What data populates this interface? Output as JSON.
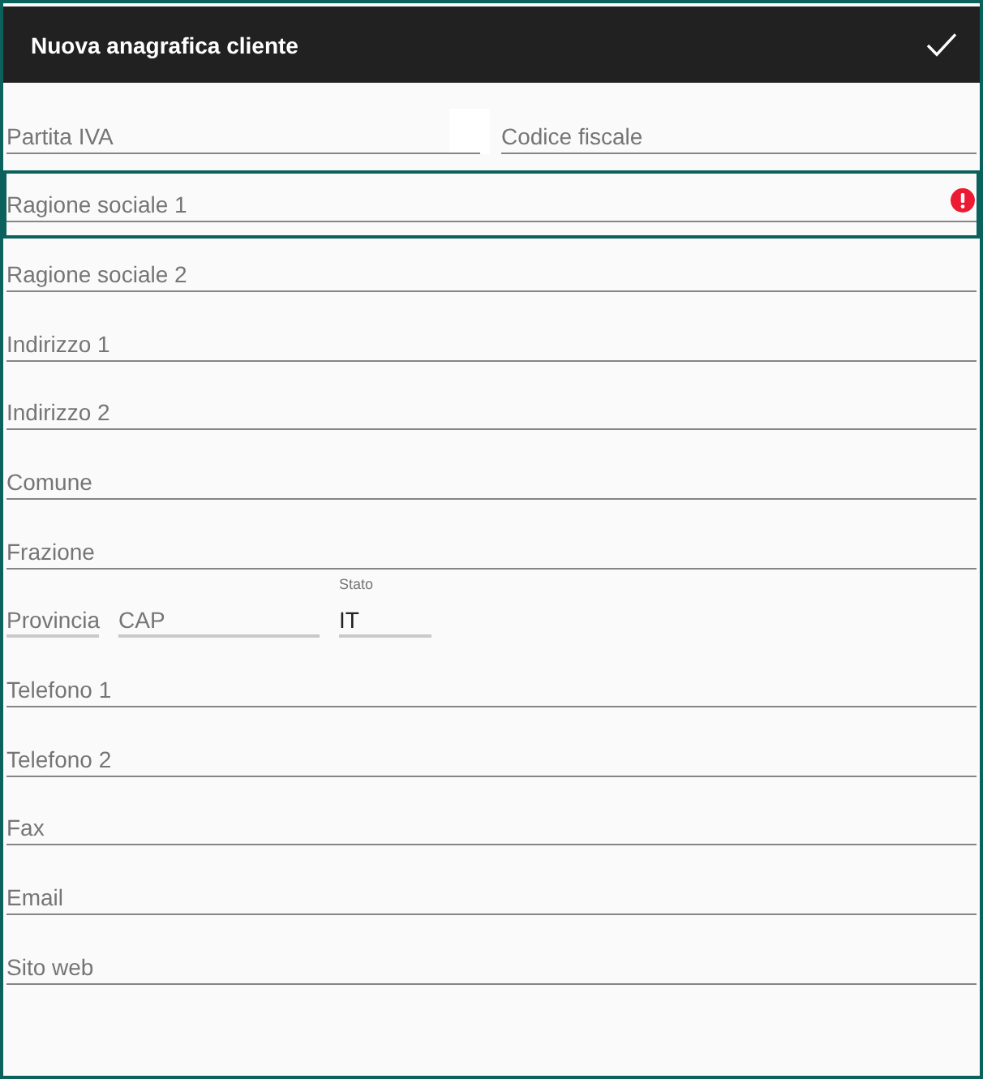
{
  "app_bar": {
    "title": "Nuova anagrafica cliente"
  },
  "form": {
    "rows": [
      {
        "kind": "pair",
        "fields": [
          {
            "placeholder": "Partita IVA",
            "focused": false,
            "error": false
          },
          {
            "placeholder": "Codice fiscale",
            "focused": false,
            "error": false
          }
        ]
      },
      {
        "kind": "full",
        "fields": [
          {
            "placeholder": "Ragione sociale 1",
            "focused": true,
            "error": true
          }
        ]
      },
      {
        "kind": "full",
        "fields": [
          {
            "placeholder": "Ragione sociale 2",
            "focused": false,
            "error": false
          }
        ]
      },
      {
        "kind": "full",
        "fields": [
          {
            "placeholder": "Indirizzo 1",
            "focused": false,
            "error": false
          }
        ]
      },
      {
        "kind": "full",
        "fields": [
          {
            "placeholder": "Indirizzo 2",
            "focused": false,
            "error": false
          }
        ]
      },
      {
        "kind": "full",
        "fields": [
          {
            "placeholder": "Comune",
            "focused": false,
            "error": false
          }
        ]
      },
      {
        "kind": "full",
        "fields": [
          {
            "placeholder": "Frazione",
            "focused": false,
            "error": false
          }
        ]
      },
      {
        "kind": "triple",
        "fields": [
          {
            "placeholder": "Provincia",
            "focused": false,
            "error": false
          },
          {
            "placeholder": "CAP",
            "focused": false,
            "error": false
          },
          {
            "label": "Stato",
            "value": "IT",
            "focused": false,
            "error": false
          }
        ]
      },
      {
        "kind": "full",
        "fields": [
          {
            "placeholder": "Telefono 1",
            "focused": false,
            "error": false
          }
        ]
      },
      {
        "kind": "full",
        "fields": [
          {
            "placeholder": "Telefono 2",
            "focused": false,
            "error": false
          }
        ]
      },
      {
        "kind": "full",
        "fields": [
          {
            "placeholder": "Fax",
            "focused": false,
            "error": false
          }
        ]
      },
      {
        "kind": "full",
        "fields": [
          {
            "placeholder": "Email",
            "focused": false,
            "error": false
          }
        ]
      },
      {
        "kind": "full",
        "fields": [
          {
            "placeholder": "Sito web",
            "focused": false,
            "error": false
          }
        ]
      }
    ]
  }
}
